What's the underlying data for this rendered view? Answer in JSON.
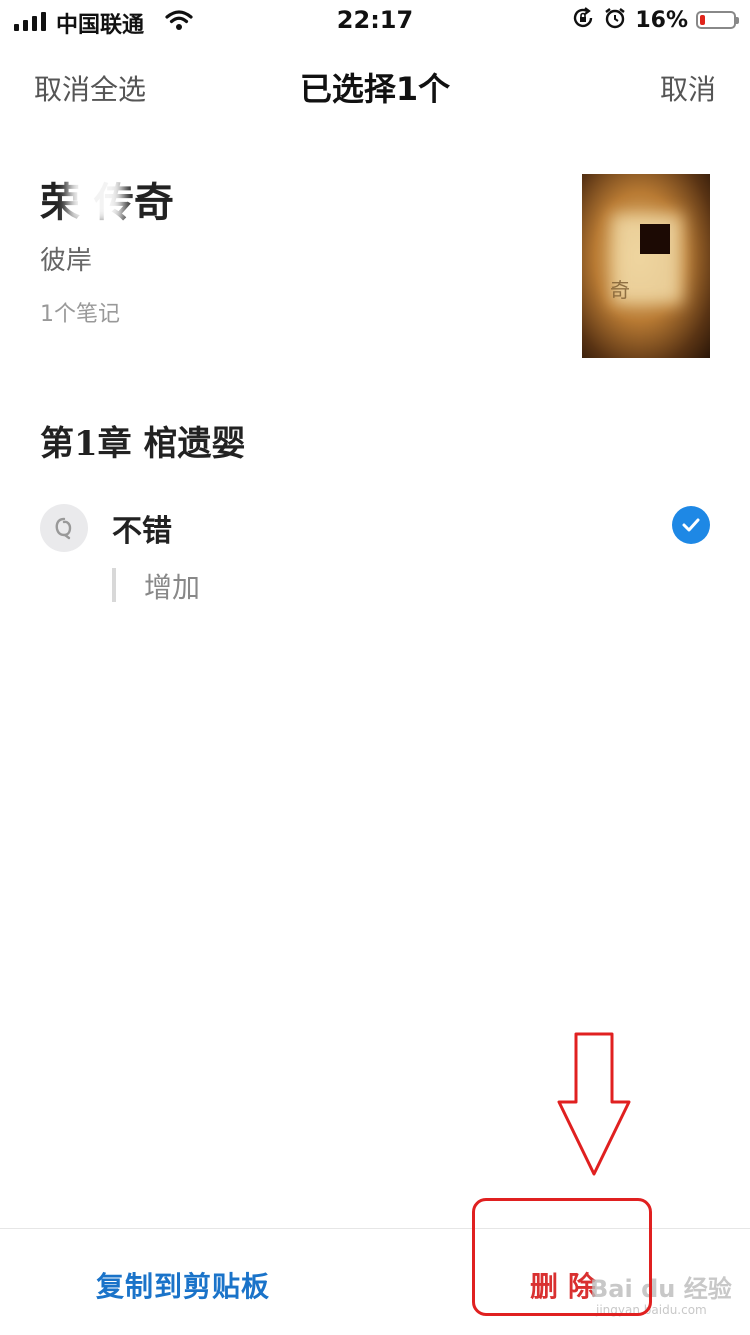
{
  "status_bar": {
    "carrier": "中国联通",
    "time": "22:17",
    "battery_percent": "16%",
    "battery_level": 0.16,
    "icons": [
      "signal-icon",
      "wifi-icon",
      "rotation-lock-icon",
      "alarm-icon",
      "battery-icon"
    ]
  },
  "nav": {
    "select_all": "取消全选",
    "title": "已选择1个",
    "cancel": "取消"
  },
  "book": {
    "title": "荣  传奇",
    "author": "彼岸",
    "note_count": "1个笔记",
    "cover_text": "奇"
  },
  "chapter": {
    "title": "第1章 棺遗婴"
  },
  "note": {
    "text": "不错",
    "quote": "增加",
    "selected": true
  },
  "toolbar": {
    "copy_label": "复制到剪贴板",
    "delete_label": "删除"
  },
  "watermark": {
    "text": "Bai du 经验",
    "sub": "jingyan.baidu.com"
  },
  "colors": {
    "accent_blue": "#1e88e5",
    "copy_blue": "#1a73c9",
    "delete_red": "#d93030",
    "annotation_red": "#e02020"
  }
}
